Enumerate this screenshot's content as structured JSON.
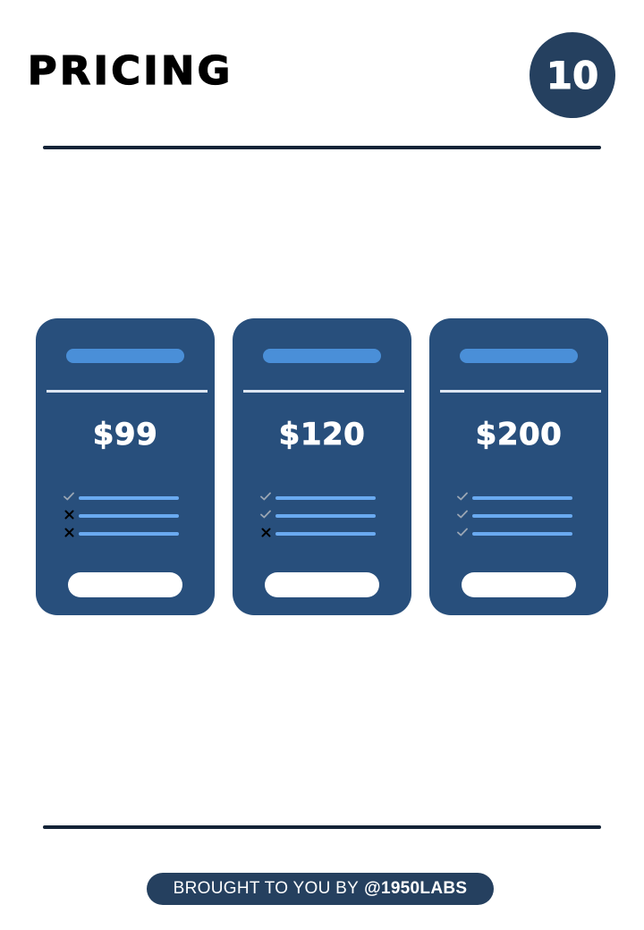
{
  "header": {
    "title": "PRICING",
    "page_number": "10"
  },
  "colors": {
    "navy": "#25405f",
    "card": "#284f7c",
    "accent": "#4a8fd8",
    "feature_line": "#6aaaf0",
    "rule": "#132337"
  },
  "plans": [
    {
      "price": "$99",
      "features": [
        "check-icon",
        "x-icon",
        "x-icon"
      ]
    },
    {
      "price": "$120",
      "features": [
        "check-icon",
        "check-icon",
        "x-icon"
      ]
    },
    {
      "price": "$200",
      "features": [
        "check-icon",
        "check-icon",
        "check-icon"
      ]
    }
  ],
  "footer": {
    "prefix": "BROUGHT TO YOU BY",
    "handle": "@1950LABS"
  }
}
